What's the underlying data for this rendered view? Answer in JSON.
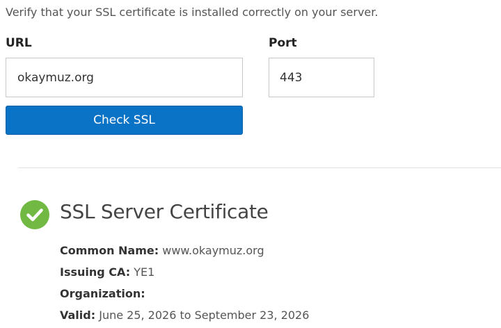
{
  "intro": "Verify that your SSL certificate is installed correctly on your server.",
  "form": {
    "url_label": "URL",
    "url_value": "okaymuz.org",
    "port_label": "Port",
    "port_value": "443",
    "check_button_label": "Check SSL"
  },
  "result": {
    "status_icon": "check-circle-icon",
    "status_color": "#72b944",
    "title": "SSL Server Certificate",
    "fields": [
      {
        "key": "Common Name:",
        "value": "www.okaymuz.org"
      },
      {
        "key": "Issuing CA:",
        "value": "YE1"
      },
      {
        "key": "Organization:",
        "value": ""
      },
      {
        "key": "Valid:",
        "value": "June 25, 2026 to September 23, 2026"
      }
    ]
  },
  "colors": {
    "button_bg": "#0a73c6",
    "success_green": "#72b944"
  }
}
